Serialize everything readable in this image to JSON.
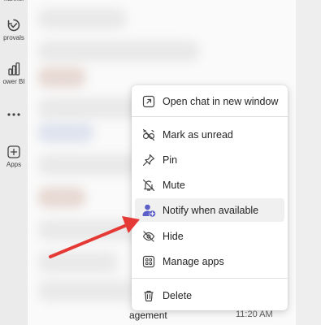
{
  "rail": {
    "items": [
      {
        "label": "hannel",
        "icon": "channel-icon"
      },
      {
        "label": "provals",
        "icon": "approvals-icon"
      },
      {
        "label": "ower BI",
        "icon": "power-bi-icon"
      },
      {
        "label": "",
        "icon": "more-icon"
      },
      {
        "label": "Apps",
        "icon": "apps-icon"
      }
    ]
  },
  "chat_list": {
    "bottom_item_label": "agement",
    "bottom_item_time": "11:20 AM"
  },
  "context_menu": {
    "items": [
      {
        "label": "Open chat in new window",
        "icon": "open-in-new-window-icon"
      },
      {
        "label": "Mark as unread",
        "icon": "mark-unread-icon"
      },
      {
        "label": "Pin",
        "icon": "pin-icon"
      },
      {
        "label": "Mute",
        "icon": "mute-icon"
      },
      {
        "label": "Notify when available",
        "icon": "notify-person-icon"
      },
      {
        "label": "Hide",
        "icon": "hide-icon"
      },
      {
        "label": "Manage apps",
        "icon": "manage-apps-icon"
      },
      {
        "label": "Delete",
        "icon": "delete-icon"
      }
    ],
    "highlighted_index": 4
  },
  "annotation": {
    "arrow_color": "#e53935",
    "accent_color": "#5b5fc7"
  }
}
